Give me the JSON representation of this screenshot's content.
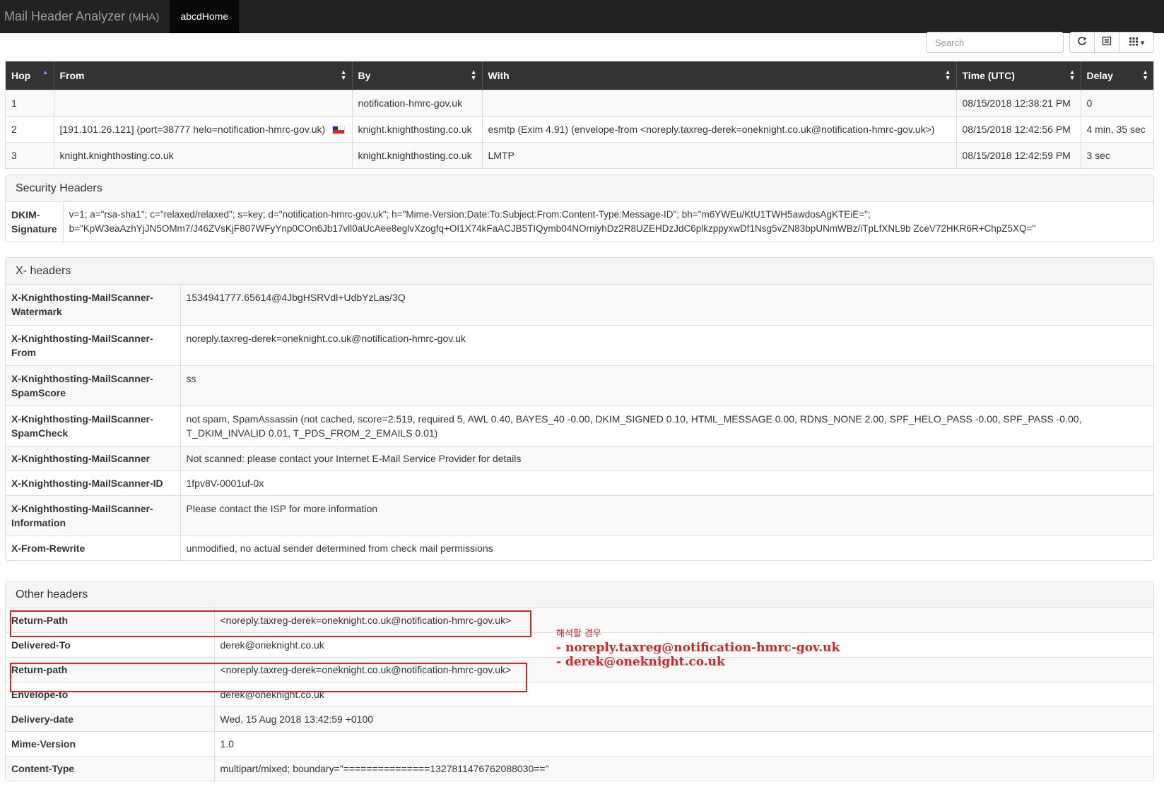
{
  "navbar": {
    "brand": "Mail Header Analyzer",
    "brand_suffix": "(MHA)",
    "tab": "abcdHome"
  },
  "toolbar": {
    "search_placeholder": "Search",
    "refresh_icon": "refresh-icon",
    "list_icon": "list-icon",
    "columns_icon": "columns-grid-icon",
    "dropdown_caret": "▾"
  },
  "hops": {
    "columns": [
      "Hop",
      "From",
      "By",
      "With",
      "Time (UTC)",
      "Delay"
    ],
    "rows": [
      {
        "hop": "1",
        "from": "",
        "by": "notification-hmrc-gov.uk",
        "with": "",
        "time": "08/15/2018 12:38:21 PM",
        "delay": "0"
      },
      {
        "hop": "2",
        "from": "[191.101.26.121] (port=38777 helo=notification-hmrc-gov.uk)",
        "by": "knight.knighthosting.co.uk",
        "with": "esmtp (Exim 4.91) (envelope-from <noreply.taxreg-derek=oneknight.co.uk@notification-hmrc-gov.uk>)",
        "time": "08/15/2018 12:42:56 PM",
        "delay": "4 min, 35 sec"
      },
      {
        "hop": "3",
        "from": "knight.knighthosting.co.uk",
        "by": "knight.knighthosting.co.uk",
        "with": "LMTP",
        "time": "08/15/2018 12:42:59 PM",
        "delay": "3 sec"
      }
    ]
  },
  "security": {
    "title": "Security Headers",
    "rows": [
      {
        "key_line1": "DKIM-",
        "key_line2": "Signature",
        "value_line1": "v=1; a=\"rsa-sha1\"; c=\"relaxed/relaxed\"; s=key; d=\"notification-hmrc-gov.uk\"; h=\"Mime-Version:Date:To:Subject:From:Content-Type:Message-ID\"; bh=\"m6YWEu/KtU1TWH5awdosAgKTEiE=\";",
        "value_line2": "b=\"KpW3eaAzhYjJN5OMm7/J46ZVsKjF807WFyYnp0COn6Jb17vll0aUcAee8eglvXzogfq+OI1X74kFaACJB5TIQymb04NOrniyhDz2R8UZEHDzJdC6plkzppyxwDf1Nsg5vZN83bpUNmWBz/iTpLfXNL9b ZceV72HKR6R+ChpZ5XQ=\""
      }
    ]
  },
  "xheaders": {
    "title": "X- headers",
    "rows": [
      {
        "key": "X-Knighthosting-MailScanner-Watermark",
        "value": "1534941777.65614@4JbgHSRVdl+UdbYzLas/3Q"
      },
      {
        "key": "X-Knighthosting-MailScanner-From",
        "value": "noreply.taxreg-derek=oneknight.co.uk@notification-hmrc-gov.uk"
      },
      {
        "key": "X-Knighthosting-MailScanner-SpamScore",
        "value": "ss"
      },
      {
        "key": "X-Knighthosting-MailScanner-SpamCheck",
        "value": "not spam, SpamAssassin (not cached, score=2.519, required 5, AWL 0.40, BAYES_40 -0.00, DKIM_SIGNED 0.10, HTML_MESSAGE 0.00, RDNS_NONE 2.00, SPF_HELO_PASS -0.00, SPF_PASS -0.00, T_DKIM_INVALID 0.01, T_PDS_FROM_2_EMAILS 0.01)"
      },
      {
        "key": "X-Knighthosting-MailScanner",
        "value": "Not scanned: please contact your Internet E-Mail Service Provider for details"
      },
      {
        "key": "X-Knighthosting-MailScanner-ID",
        "value": "1fpv8V-0001uf-0x"
      },
      {
        "key": "X-Knighthosting-MailScanner-Information",
        "value": "Please contact the ISP for more information"
      },
      {
        "key": "X-From-Rewrite",
        "value": "unmodified, no actual sender determined from check mail permissions"
      }
    ]
  },
  "other": {
    "title": "Other headers",
    "rows": [
      {
        "key": "Return-Path",
        "value": "<noreply.taxreg-derek=oneknight.co.uk@notification-hmrc-gov.uk>"
      },
      {
        "key": "Delivered-To",
        "value": "derek@oneknight.co.uk"
      },
      {
        "key": "Return-path",
        "value": "<noreply.taxreg-derek=oneknight.co.uk@notification-hmrc-gov.uk>"
      },
      {
        "key": "Envelope-to",
        "value": "derek@oneknight.co.uk"
      },
      {
        "key": "Delivery-date",
        "value": "Wed, 15 Aug 2018 13:42:59 +0100"
      },
      {
        "key": "Mime-Version",
        "value": "1.0"
      },
      {
        "key": "Content-Type",
        "value": "multipart/mixed; boundary=\"===============1327811476762088030==\""
      }
    ]
  },
  "annotation": {
    "title": "해석할 경우",
    "line1": "- noreply.taxreg@notification-hmrc-gov.uk",
    "line2": "- derek@oneknight.co.uk",
    "color": "#e02020"
  },
  "colors": {
    "navbar": "#222222",
    "table_header": "#333333",
    "annotation_red": "#e02020"
  }
}
